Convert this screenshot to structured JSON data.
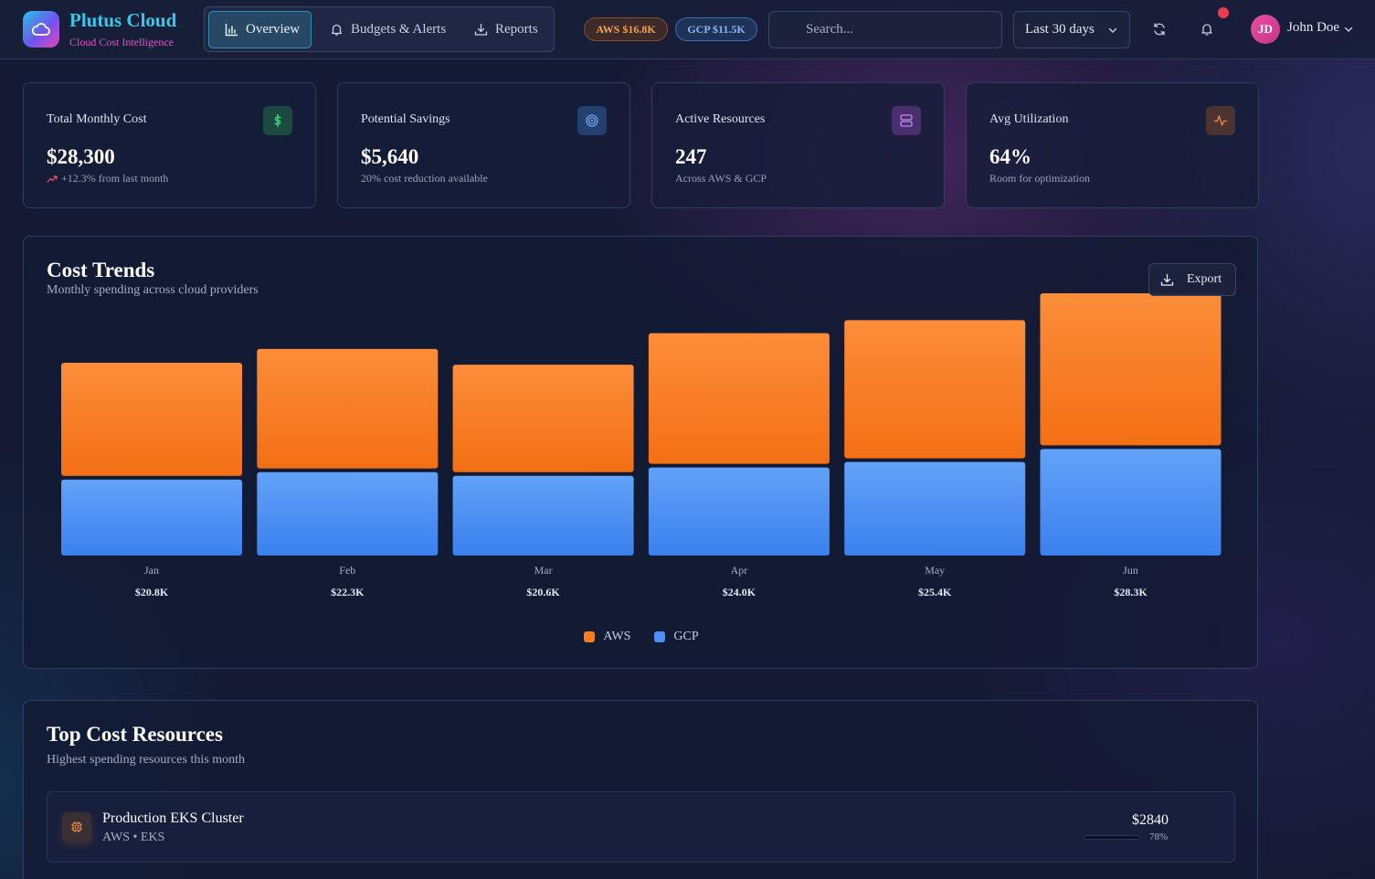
{
  "brand": {
    "name": "Plutus Cloud",
    "tagline": "Cloud Cost Intelligence"
  },
  "nav": {
    "items": [
      {
        "label": "Overview",
        "icon": "bar-chart-icon",
        "active": true
      },
      {
        "label": "Budgets & Alerts",
        "icon": "bell-icon",
        "active": false
      },
      {
        "label": "Reports",
        "icon": "download-icon",
        "active": false
      }
    ]
  },
  "badges": {
    "aws": "AWS $16.8K",
    "gcp": "GCP $11.5K"
  },
  "search": {
    "placeholder": "Search..."
  },
  "date_range": {
    "selected": "Last 30 days"
  },
  "user": {
    "initials": "JD",
    "name": "John Doe"
  },
  "colors": {
    "aws": "#f97d1f",
    "gcp": "#4f8ef5",
    "accent": "#38c9ea",
    "alert": "#ef3b52"
  },
  "stats": [
    {
      "title": "Total Monthly Cost",
      "value": "$28,300",
      "sub": "+12.3% from last month",
      "icon": "dollar-icon"
    },
    {
      "title": "Potential Savings",
      "value": "$5,640",
      "sub": "20% cost reduction available",
      "icon": "target-icon"
    },
    {
      "title": "Active Resources",
      "value": "247",
      "sub": "Across AWS & GCP",
      "icon": "server-icon"
    },
    {
      "title": "Avg Utilization",
      "value": "64%",
      "sub": "Room for optimization",
      "icon": "activity-icon"
    }
  ],
  "cost_trends": {
    "title": "Cost Trends",
    "subtitle": "Monthly spending across cloud providers",
    "export_label": "Export"
  },
  "chart_data": {
    "type": "bar",
    "stacked": true,
    "categories": [
      "Jan",
      "Feb",
      "Mar",
      "Apr",
      "May",
      "Jun"
    ],
    "totals_labels": [
      "$20.8K",
      "$22.3K",
      "$20.6K",
      "$24.0K",
      "$25.4K",
      "$28.3K"
    ],
    "series": [
      {
        "name": "GCP",
        "values": [
          8.2,
          9.0,
          8.6,
          9.5,
          10.1,
          11.5
        ]
      },
      {
        "name": "AWS",
        "values": [
          12.6,
          13.3,
          12.0,
          14.5,
          15.3,
          16.8
        ]
      }
    ],
    "ylim": [
      0,
      28.3
    ],
    "legend_position": "bottom-center",
    "grid": false
  },
  "top_resources": {
    "title": "Top Cost Resources",
    "subtitle": "Highest spending resources this month",
    "items": [
      {
        "name": "Production EKS Cluster",
        "meta": "AWS • EKS",
        "cost": "$2840",
        "utilization_label": "78%",
        "utilization": 0.78,
        "icon": "cpu-icon"
      }
    ]
  }
}
